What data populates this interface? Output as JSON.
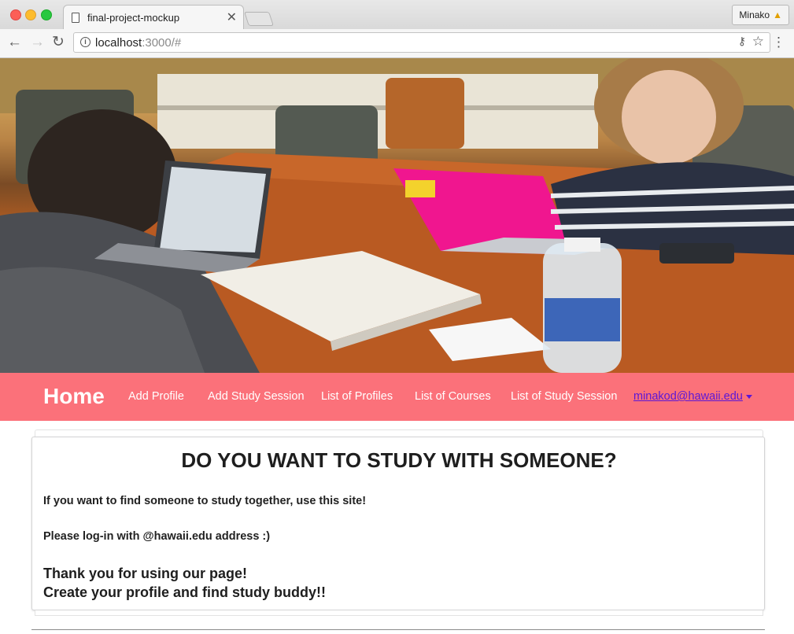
{
  "browser": {
    "tab_title": "final-project-mockup",
    "tab_close": "✕",
    "profile_name": "Minako",
    "url_host": "localhost",
    "url_rest": ":3000/#"
  },
  "navbar": {
    "home": "Home",
    "links": [
      "Add Profile",
      "Add Study Session",
      "List of Profiles",
      "List of Courses",
      "List of Study Session"
    ],
    "user_email": "minakod@hawaii.edu",
    "bg_color": "#fb717a"
  },
  "main": {
    "headline": "DO YOU WANT TO STUDY WITH SOMEONE?",
    "intro": "If you want to find someone to study together, use this site!",
    "login_note": "Please log-in with @hawaii.edu address :)",
    "thanks_line1": "Thank you for using our page!",
    "thanks_line2": "Create your profile and find study buddy!!"
  }
}
